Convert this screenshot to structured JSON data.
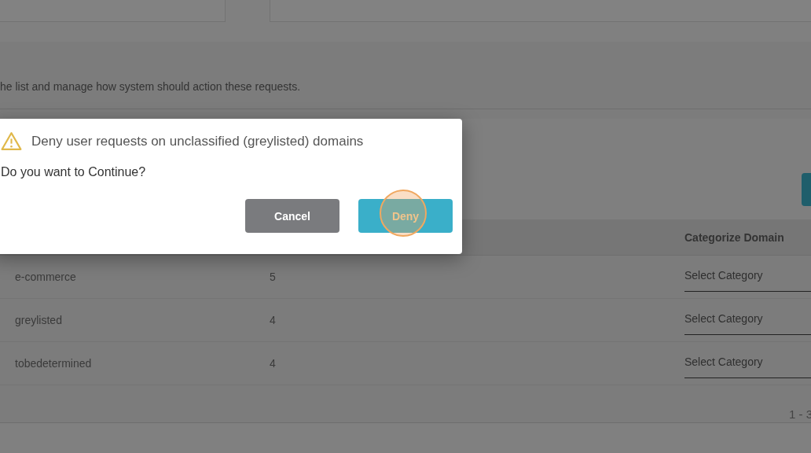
{
  "page": {
    "description": "he list and manage how system should action these requests."
  },
  "table": {
    "columns": [
      "Categorize Domain"
    ],
    "rows": [
      {
        "domain": "e-commerce",
        "count": "5",
        "category_placeholder": "Select Category"
      },
      {
        "domain": "greylisted",
        "count": "4",
        "category_placeholder": "Select Category"
      },
      {
        "domain": "tobedetermined",
        "count": "4",
        "category_placeholder": "Select Category"
      }
    ],
    "pagination": "1 - 3"
  },
  "dialog": {
    "title": "Deny user requests on unclassified (greylisted) domains",
    "message": "Do you want to Continue?",
    "buttons": [
      {
        "label": "Cancel",
        "kind": "secondary",
        "clicked": false
      },
      {
        "label": "Deny",
        "kind": "primary",
        "clicked": true
      }
    ]
  }
}
